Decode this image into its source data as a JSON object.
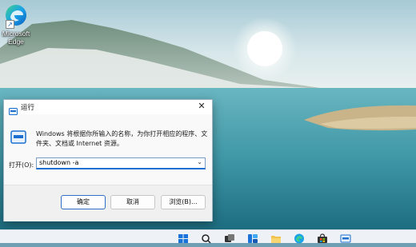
{
  "desktop": {
    "icons": [
      {
        "label": "Microsoft Edge",
        "icon": "edge-icon"
      }
    ]
  },
  "run_dialog": {
    "title": "运行",
    "description": "Windows 将根据你所输入的名称，为你打开相应的程序、文件夹、文档或 Internet 资源。",
    "open_label": "打开(O):",
    "open_value": "shutdown -a",
    "buttons": {
      "ok": "确定",
      "cancel": "取消",
      "browse": "浏览(B)..."
    },
    "close_glyph": "✕",
    "dropdown_glyph": "⌄"
  },
  "taskbar": {
    "items": [
      {
        "name": "start-button-icon"
      },
      {
        "name": "search-icon"
      },
      {
        "name": "task-view-icon"
      },
      {
        "name": "widgets-icon"
      },
      {
        "name": "file-explorer-icon"
      },
      {
        "name": "edge-icon"
      },
      {
        "name": "store-icon"
      },
      {
        "name": "run-app-icon"
      }
    ]
  },
  "colors": {
    "accent": "#1c6fd1",
    "sky_top": "#9ec4d3",
    "water": "#3f97a6",
    "taskbar": "#eef2f6"
  }
}
